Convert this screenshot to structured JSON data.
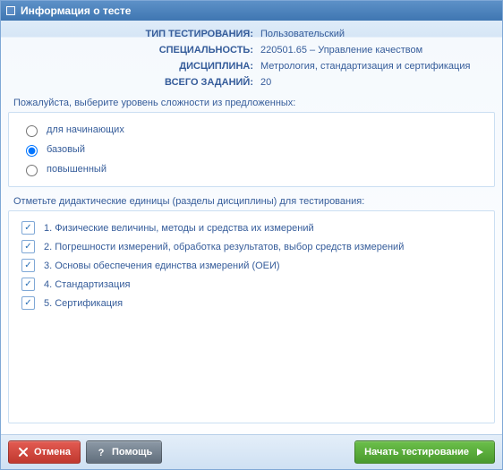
{
  "window": {
    "title": "Информация о тесте"
  },
  "info": {
    "rows": [
      {
        "label": "ТИП ТЕСТИРОВАНИЯ:",
        "value": "Пользовательский"
      },
      {
        "label": "СПЕЦИАЛЬНОСТЬ:",
        "value": "220501.65 – Управление качеством"
      },
      {
        "label": "ДИСЦИПЛИНА:",
        "value": "Метрология, стандартизация и сертификация"
      },
      {
        "label": "ВСЕГО ЗАДАНИЙ:",
        "value": "20"
      }
    ]
  },
  "difficulty": {
    "prompt": "Пожалуйста, выберите уровень сложности из предложенных:",
    "options": [
      {
        "label": "для начинающих",
        "selected": false
      },
      {
        "label": "базовый",
        "selected": true
      },
      {
        "label": "повышенный",
        "selected": false
      }
    ]
  },
  "units": {
    "prompt": "Отметьте дидактические единицы (разделы дисциплины) для тестирования:",
    "items": [
      {
        "label": "1. Физические величины, методы и средства их измерений",
        "checked": true
      },
      {
        "label": "2. Погрешности измерений, обработка результатов, выбор средств измерений",
        "checked": true
      },
      {
        "label": "3. Основы обеспечения единства измерений (ОЕИ)",
        "checked": true
      },
      {
        "label": "4. Стандартизация",
        "checked": true
      },
      {
        "label": "5. Сертификация",
        "checked": true
      }
    ]
  },
  "buttons": {
    "cancel": "Отмена",
    "help": "Помощь",
    "start": "Начать тестирование"
  }
}
